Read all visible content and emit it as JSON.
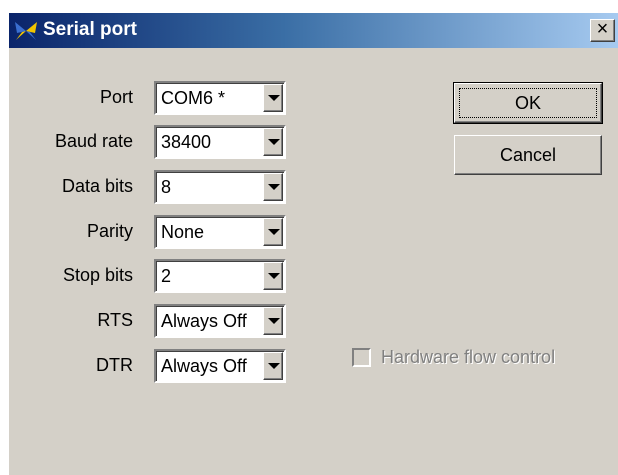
{
  "window": {
    "title": "Serial port",
    "close_symbol": "×",
    "icon": "butterfly-logo-icon"
  },
  "fields": [
    {
      "label": "Port",
      "value": "COM6 *"
    },
    {
      "label": "Baud rate",
      "value": "38400"
    },
    {
      "label": "Data bits",
      "value": "8"
    },
    {
      "label": "Parity",
      "value": "None"
    },
    {
      "label": "Stop bits",
      "value": "2"
    },
    {
      "label": "RTS",
      "value": "Always Off"
    },
    {
      "label": "DTR",
      "value": "Always Off"
    }
  ],
  "buttons": {
    "ok": "OK",
    "cancel": "Cancel"
  },
  "hardware_flow_control": {
    "label": "Hardware flow control",
    "checked": false,
    "enabled": false
  },
  "colors": {
    "titlebar_start": "#0a246a",
    "titlebar_end": "#a6caf0",
    "dialog_face": "#d4d0c8",
    "logo_blue": "#3a6fd0",
    "logo_yellow": "#f2c500"
  }
}
